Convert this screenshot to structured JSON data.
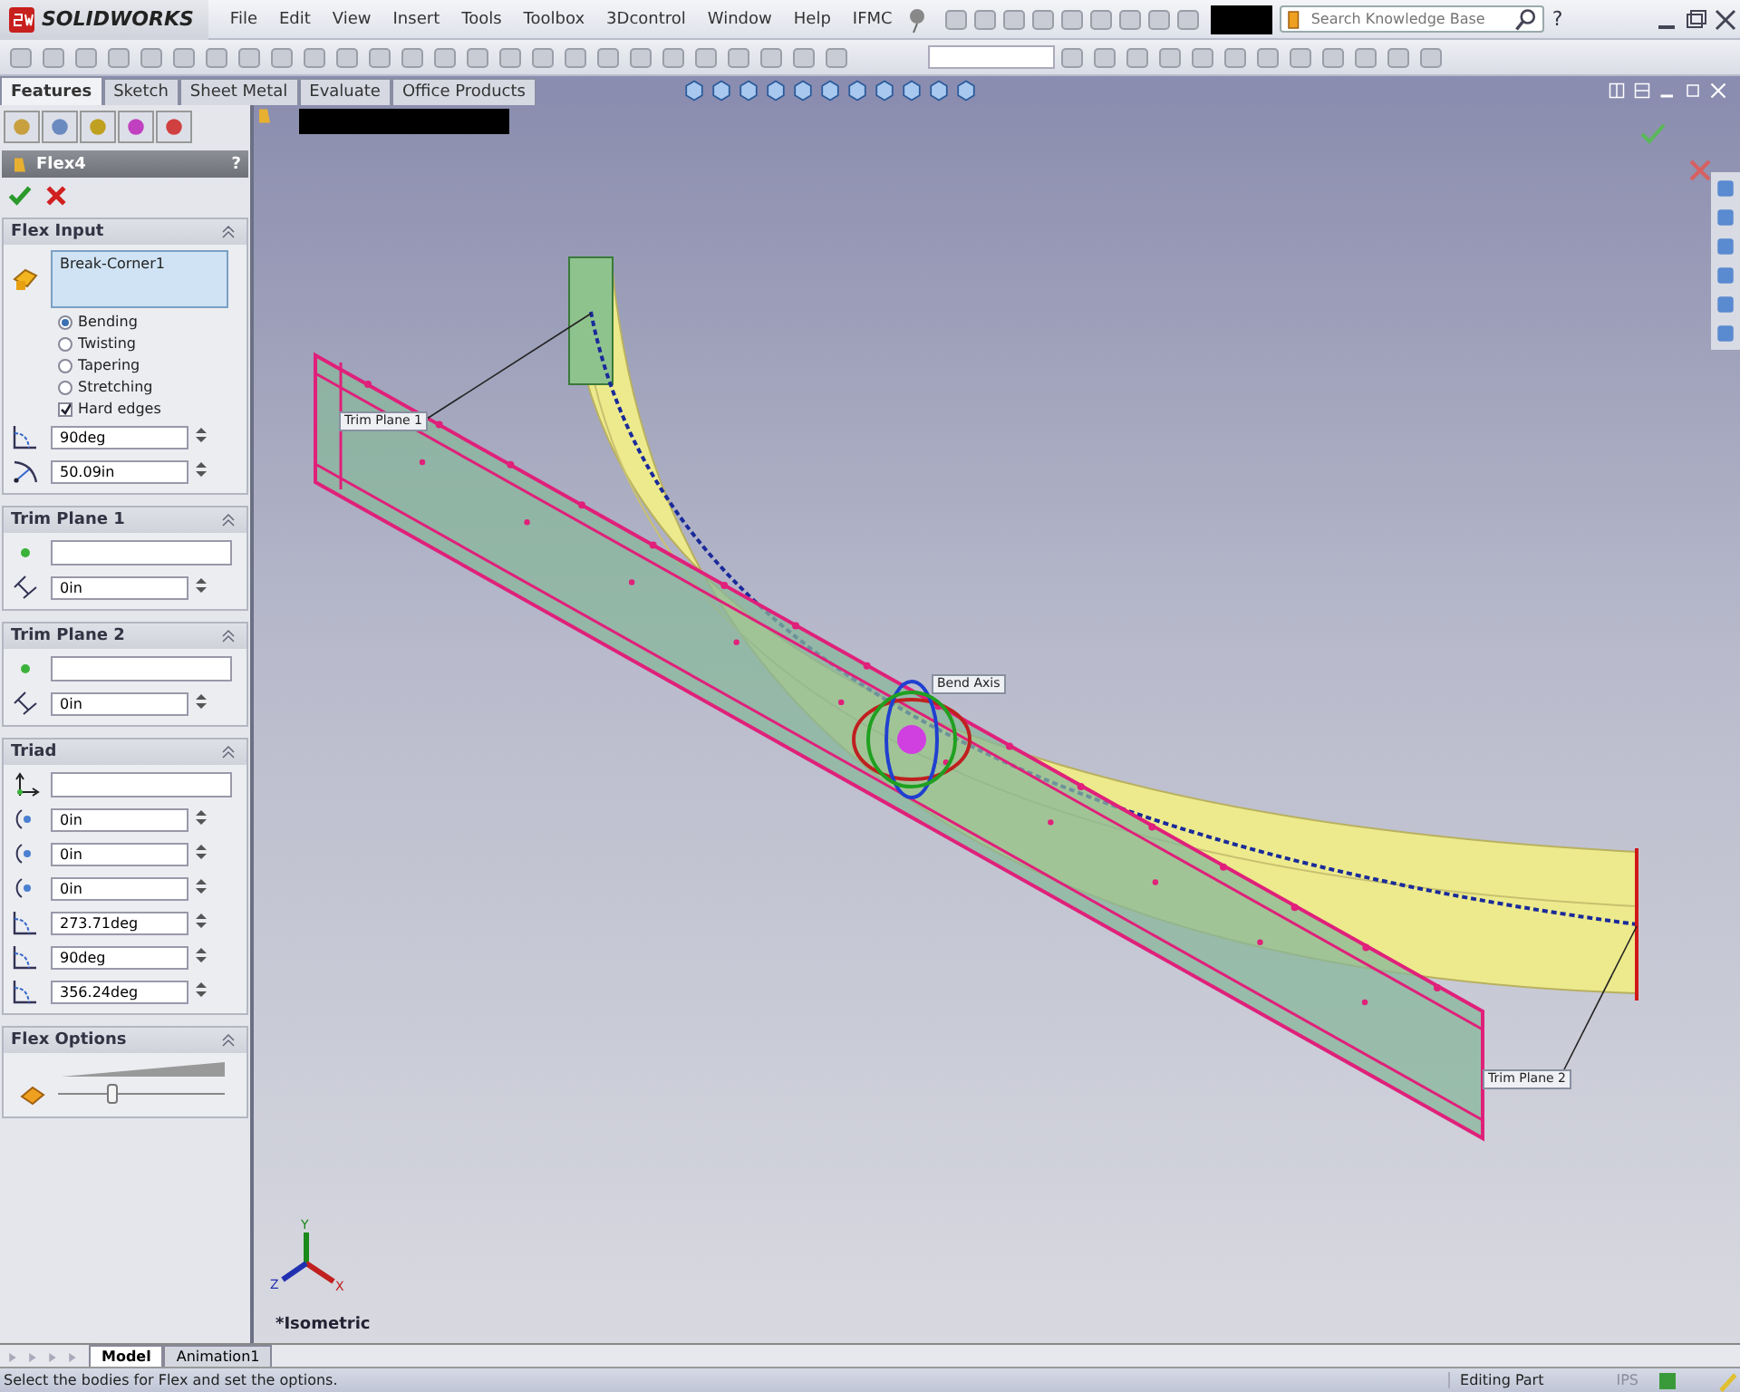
{
  "app": {
    "logo_text": "SOLIDWORKS"
  },
  "menu": [
    "File",
    "Edit",
    "View",
    "Insert",
    "Tools",
    "Toolbox",
    "3Dcontrol",
    "Window",
    "Help",
    "IFMC"
  ],
  "search": {
    "placeholder": "Search Knowledge Base"
  },
  "help_button": "?",
  "command_tabs": [
    {
      "label": "Features",
      "selected": true
    },
    {
      "label": "Sketch",
      "selected": false
    },
    {
      "label": "Sheet Metal",
      "selected": false
    },
    {
      "label": "Evaluate",
      "selected": false
    },
    {
      "label": "Office Products",
      "selected": false
    }
  ],
  "property_manager": {
    "title": "Flex4",
    "help": "?",
    "sections": [
      {
        "title": "Flex Input",
        "rows": [
          {
            "kind": "selection",
            "value": "Break-Corner1"
          },
          {
            "kind": "radio",
            "label": "Bending",
            "selected": true
          },
          {
            "kind": "radio",
            "label": "Twisting",
            "selected": false
          },
          {
            "kind": "radio",
            "label": "Tapering",
            "selected": false
          },
          {
            "kind": "radio",
            "label": "Stretching",
            "selected": false
          },
          {
            "kind": "checkbox",
            "label": "Hard edges",
            "checked": true
          },
          {
            "kind": "angle",
            "value": "90deg"
          },
          {
            "kind": "radius",
            "value": "50.09in"
          }
        ]
      },
      {
        "title": "Trim Plane 1",
        "rows": [
          {
            "kind": "point"
          },
          {
            "kind": "offset",
            "value": "0in"
          }
        ]
      },
      {
        "title": "Trim Plane 2",
        "rows": [
          {
            "kind": "point"
          },
          {
            "kind": "offset",
            "value": "0in"
          }
        ]
      },
      {
        "title": "Triad",
        "rows": [
          {
            "kind": "axes"
          },
          {
            "kind": "rotate",
            "value": "0in"
          },
          {
            "kind": "rotate",
            "value": "0in"
          },
          {
            "kind": "rotate",
            "value": "0in"
          },
          {
            "kind": "angle",
            "value": "273.71deg"
          },
          {
            "kind": "angle",
            "value": "90deg"
          },
          {
            "kind": "angle",
            "value": "356.24deg"
          }
        ]
      },
      {
        "title": "Flex Options",
        "rows": [
          {
            "kind": "slider",
            "level": 0.33
          }
        ]
      }
    ]
  },
  "viewport": {
    "labels": [
      "Trim Plane 1",
      "Bend Axis",
      "Trim Plane 2"
    ],
    "triad_axes": [
      "Y",
      "Z",
      "X"
    ],
    "view_name": "*Isometric"
  },
  "bottom_tabs": [
    {
      "label": "Model",
      "selected": true
    },
    {
      "label": "Animation1",
      "selected": false
    }
  ],
  "status_bar": {
    "message": "Select the bodies for Flex and set the options.",
    "mode": "Editing Part",
    "units": "IPS"
  }
}
